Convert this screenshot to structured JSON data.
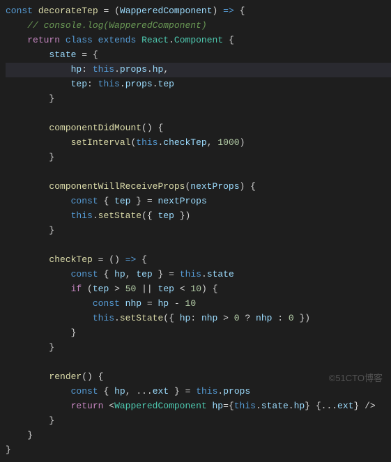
{
  "code": {
    "l1": {
      "a": "const",
      "b": "decorateTep",
      "c": "=",
      "d": "(",
      "e": "WapperedComponent",
      "f": ")",
      "g": "=>",
      "h": "{"
    },
    "l2": {
      "cmt": "// console.log(WapperedComponent)"
    },
    "l3": {
      "a": "return",
      "b": "class",
      "c": "extends",
      "d": "React",
      "e": ".",
      "f": "Component",
      "g": "{"
    },
    "l4": {
      "a": "state",
      "b": "=",
      "c": "{"
    },
    "l5": {
      "a": "hp",
      "b": ":",
      "c": "this",
      "d": ".",
      "e": "props",
      "f": ".",
      "g": "hp",
      "h": ","
    },
    "l6": {
      "a": "tep",
      "b": ":",
      "c": "this",
      "d": ".",
      "e": "props",
      "f": ".",
      "g": "tep"
    },
    "l7": {
      "a": "}"
    },
    "l8": {
      "a": "componentDidMount",
      "b": "()",
      "c": "{"
    },
    "l9": {
      "a": "setInterval",
      "b": "(",
      "c": "this",
      "d": ".",
      "e": "checkTep",
      "f": ",",
      "g": "1000",
      "h": ")"
    },
    "l10": {
      "a": "}"
    },
    "l11": {
      "a": "componentWillReceiveProps",
      "b": "(",
      "c": "nextProps",
      "d": ")",
      "e": "{"
    },
    "l12": {
      "a": "const",
      "b": "{",
      "c": "tep",
      "d": "}",
      "e": "=",
      "f": "nextProps"
    },
    "l13": {
      "a": "this",
      "b": ".",
      "c": "setState",
      "d": "({",
      "e": "tep",
      "f": "})"
    },
    "l14": {
      "a": "}"
    },
    "l15": {
      "a": "checkTep",
      "b": "=",
      "c": "()",
      "d": "=>",
      "e": "{"
    },
    "l16": {
      "a": "const",
      "b": "{",
      "c": "hp",
      "d": ",",
      "e": "tep",
      "f": "}",
      "g": "=",
      "h": "this",
      "i": ".",
      "j": "state"
    },
    "l17": {
      "a": "if",
      "b": "(",
      "c": "tep",
      "d": ">",
      "e": "50",
      "f": "||",
      "g": "tep",
      "h": "<",
      "i": "10",
      "j": ")",
      "k": "{"
    },
    "l18": {
      "a": "const",
      "b": "nhp",
      "c": "=",
      "d": "hp",
      "e": "-",
      "f": "10"
    },
    "l19": {
      "a": "this",
      "b": ".",
      "c": "setState",
      "d": "({",
      "e": "hp",
      "f": ":",
      "g": "nhp",
      "h": ">",
      "i": "0",
      "j": "?",
      "k": "nhp",
      "l": ":",
      "m": "0",
      "n": "})"
    },
    "l20": {
      "a": "}"
    },
    "l21": {
      "a": "}"
    },
    "l22": {
      "a": "render",
      "b": "()",
      "c": "{"
    },
    "l23": {
      "a": "const",
      "b": "{",
      "c": "hp",
      "d": ",",
      "e": "...",
      "f": "ext",
      "g": "}",
      "h": "=",
      "i": "this",
      "j": ".",
      "k": "props"
    },
    "l24": {
      "a": "return",
      "b": "<",
      "c": "WapperedComponent",
      "d": "hp",
      "e": "=",
      "f": "{",
      "g": "this",
      "h": ".",
      "i": "state",
      "j": ".",
      "k": "hp",
      "l": "}",
      "m": "{",
      "n": "...",
      "o": "ext",
      "p": "}",
      "q": "/>"
    },
    "l25": {
      "a": "}"
    },
    "l26": {
      "a": "}"
    },
    "l27": {
      "a": "}"
    }
  },
  "watermark": "©51CTO博客"
}
